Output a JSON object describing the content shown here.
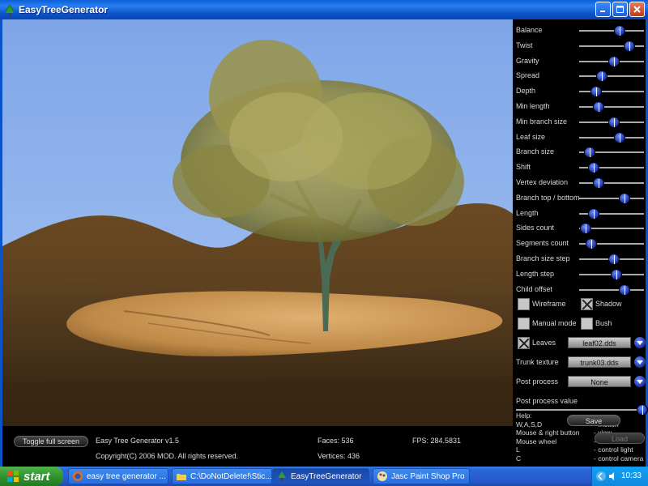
{
  "window": {
    "title": "EasyTreeGenerator"
  },
  "sliders": [
    {
      "label": "Balance",
      "level": 0.62
    },
    {
      "label": "Twist",
      "level": 0.78
    },
    {
      "label": "Gravity",
      "level": 0.52
    },
    {
      "label": "Spread",
      "level": 0.3
    },
    {
      "label": "Depth",
      "level": 0.2
    },
    {
      "label": "Min length",
      "level": 0.24
    },
    {
      "label": "Min branch size",
      "level": 0.52
    },
    {
      "label": "Leaf size",
      "level": 0.62
    },
    {
      "label": "Branch size",
      "level": 0.08
    },
    {
      "label": "Shift",
      "level": 0.16
    },
    {
      "label": "Vertex deviation",
      "level": 0.24
    },
    {
      "label": "Branch top / bottom",
      "level": 0.7
    },
    {
      "label": "Length",
      "level": 0.16
    },
    {
      "label": "Sides count",
      "level": 0.02
    },
    {
      "label": "Segments count",
      "level": 0.12
    },
    {
      "label": "Branch size step",
      "level": 0.52
    },
    {
      "label": "Length step",
      "level": 0.56
    },
    {
      "label": "Child offset",
      "level": 0.7
    }
  ],
  "checkboxes": {
    "wireframe": {
      "label": "Wireframe",
      "checked": false
    },
    "shadow": {
      "label": "Shadow",
      "checked": true
    },
    "manual_mode": {
      "label": "Manual mode",
      "checked": false
    },
    "bush": {
      "label": "Bush",
      "checked": false
    },
    "leaves": {
      "label": "Leaves",
      "checked": true
    }
  },
  "combos": {
    "leaves_texture": "leaf02.dds",
    "trunk": {
      "label": "Trunk texture",
      "value": "trunk03.dds"
    },
    "post_process": {
      "label": "Post process",
      "value": "None"
    }
  },
  "post_process_value": {
    "label": "Post process value",
    "level": 0.99
  },
  "buttons": {
    "save": "Save",
    "load": "Load",
    "toggle_full_screen": "Toggle full screen"
  },
  "help": {
    "title": "Help:",
    "rows": [
      {
        "key": "W,A,S,D",
        "desc": "- motion"
      },
      {
        "key": "Mouse & right button",
        "desc": "- view"
      },
      {
        "key": "Mouse wheel",
        "desc": "- FOV"
      },
      {
        "key": "L",
        "desc": "- control light"
      },
      {
        "key": "C",
        "desc": "- control camera"
      }
    ]
  },
  "status": {
    "version": "Easy Tree Generator v1.5",
    "copyright": "Copyright(C) 2006 MOD. All rights reserved.",
    "faces": "Faces: 536",
    "vertices": "Vertices: 436",
    "fps": "FPS: 284.5831"
  },
  "taskbar": {
    "start": "start",
    "tasks": [
      {
        "label": "easy tree generator ...",
        "icon": "firefox-icon",
        "active": false
      },
      {
        "label": "C:\\DoNotDelete!\\Stic...",
        "icon": "folder-icon",
        "active": false
      },
      {
        "label": "EasyTreeGenerator",
        "icon": "tree-icon",
        "active": true
      },
      {
        "label": "Jasc Paint Shop Pro",
        "icon": "paint-icon",
        "active": false
      }
    ],
    "clock": "10:33"
  },
  "colors": {
    "sky": "#7ea6e8",
    "knob": "#2a44c8",
    "title_bar": "#0b53c8",
    "taskbar": "#2458c8"
  }
}
